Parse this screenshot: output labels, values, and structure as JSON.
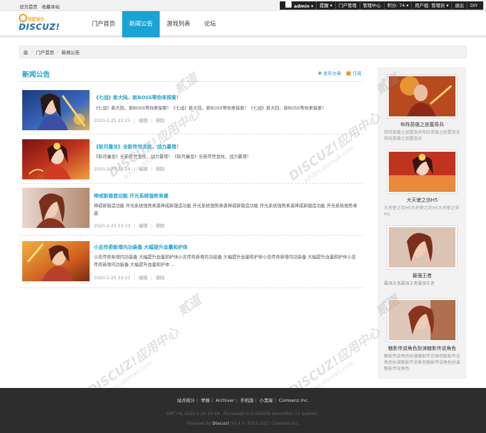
{
  "topbar": {
    "left_links": [
      "设为首页",
      "收藏本站"
    ],
    "username": "admin",
    "items": [
      "提醒",
      "门户管理",
      "管理中心",
      "积分: 74",
      "用户组: 管理员",
      "退出",
      "DIY"
    ]
  },
  "logo": {
    "sub": "社区动力",
    "main": "DISCUZ!"
  },
  "nav": {
    "items": [
      "门户首页",
      "新闻公告",
      "游戏列表",
      "论坛"
    ],
    "active_index": 1
  },
  "breadcrumb": {
    "items": [
      "门户首页",
      "新闻公告"
    ]
  },
  "main": {
    "title": "新闻公告",
    "post_label": "发布文章",
    "subscribe_label": "订阅",
    "edit_label": "编辑",
    "delete_label": "删除",
    "articles": [
      {
        "title": "《七战》新大陆、新BOSS等你来探索！",
        "desc": "《七战》新大陆、新BOSS等你来探索！《七战》新大陆、新BOSS等你来探索！《七战》新大陆、新BOSS等你来探索！",
        "date": "2020-2-25 23:25"
      },
      {
        "title": "《斩月屠龙》全新传世龙纹，战力暴增！",
        "desc": "《斩月屠龙》全新传世龙纹，战力暴增！《斩月屠龙》全新传世龙纹，战力暴增！",
        "date": "2020-2-25 23:24"
      },
      {
        "title": "神戒新锻造功能 开光系统强势来袭",
        "desc": "神戒新锻造功能 开光系统强势来袭神戒新锻造功能 开光系统强势来袭神戒新锻造功能 开光系统强势来袭神戒新锻造功能 开光系统强势来袭",
        "date": "2020-2-25 23:23"
      },
      {
        "title": "小志传奇新增内功装备 大幅提升血量和护体",
        "desc": "小志传奇新增内功装备 大幅提升血量和护体小志传奇新增内功装备 大幅提升血量和护体小志传奇新增内功装备 大幅提升血量和护体小志传奇新增内功装备 大幅提升血量和护体 ...",
        "date": "2020-2-25 23:22"
      }
    ]
  },
  "sidebar": {
    "cards": [
      {
        "name": "布阵英雄之放置奇兵",
        "desc": "布阵英雄之放置奇兵布阵英雄之放置奇兵布阵英雄之放置奇兵"
      },
      {
        "name": "大天使之剑H5",
        "desc": "大天使之剑H5大天使之剑H5大天使之剑H5"
      },
      {
        "name": "最强王者",
        "desc": "最强王者最强王者最强王者"
      },
      {
        "name": "魅影传说角色扮演魅影传说角色",
        "desc": "魅影传说角色扮演魅影传说角色魅影传说角色扮演魅影传说角色魅影传说角色扮演魅影传说角色"
      }
    ]
  },
  "footer": {
    "links": [
      "站点统计",
      "举报",
      "Archiver",
      "手机版",
      "小黑屋",
      "Comsenz Inc."
    ],
    "info": "GMT+8, 2020-2-29 20:18 , Processed in 0.152009 second(s), 11 queries .",
    "powered": "Powered by",
    "brand": "Discuz!",
    "version": "X3.4 © 2001-2017 Comsenz Inc."
  },
  "watermark": {
    "big": "DISCUZ!应用中心",
    "small": "addon.dismall.com",
    "mark": "贰道"
  },
  "colors": {
    "accent": "#1aa3d6",
    "footer_bg": "#2d2d2d",
    "topbar_bg": "#f2f2f2"
  }
}
